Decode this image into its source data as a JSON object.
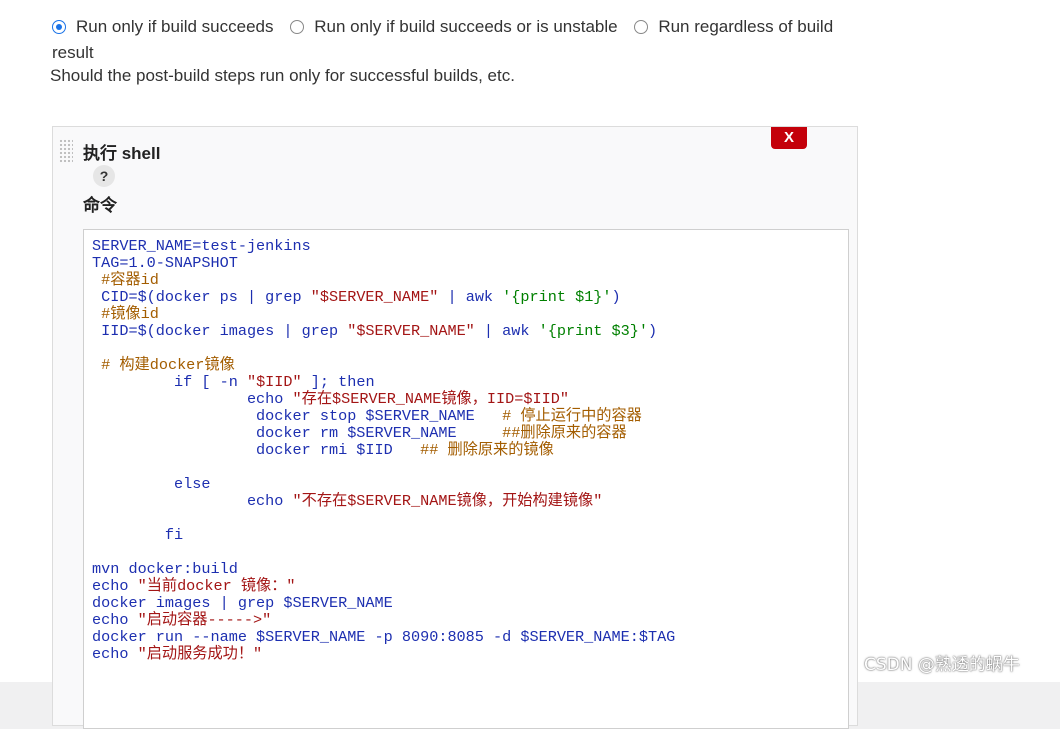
{
  "post_build": {
    "options": [
      {
        "label": "Run only if build succeeds",
        "selected": true
      },
      {
        "label": "Run only if build succeeds or is unstable",
        "selected": false
      },
      {
        "label": "Run regardless of build result",
        "selected": false
      }
    ],
    "help_text": "Should the post-build steps run only for successful builds, etc."
  },
  "step": {
    "title": "执行 shell",
    "help_label": "?",
    "delete_label": "X",
    "command_label": "命令",
    "code_lines": [
      "SERVER_NAME=test-jenkins",
      "TAG=1.0-SNAPSHOT",
      " #容器id",
      " CID=$(docker ps | grep \"$SERVER_NAME\" | awk '{print $1}')",
      " #镜像id",
      " IID=$(docker images | grep \"$SERVER_NAME\" | awk '{print $3}')",
      "",
      " # 构建docker镜像",
      "         if [ -n \"$IID\" ]; then",
      "                 echo \"存在$SERVER_NAME镜像，IID=$IID\"",
      "                  docker stop $SERVER_NAME   # 停止运行中的容器",
      "                  docker rm $SERVER_NAME     ##删除原来的容器",
      "                  docker rmi $IID   ## 删除原来的镜像",
      "",
      "         else",
      "                 echo \"不存在$SERVER_NAME镜像，开始构建镜像\"",
      "",
      "        fi",
      "",
      "mvn docker:build",
      "echo \"当前docker 镜像：\"",
      "docker images | grep $SERVER_NAME",
      "echo \"启动容器----->\"",
      "docker run --name $SERVER_NAME -p 8090:8085 -d $SERVER_NAME:$TAG",
      "echo \"启动服务成功！\""
    ]
  },
  "watermark": "CSDN @熟透的蜗牛",
  "colors": {
    "radio_accent": "#1a73e8",
    "delete_button": "#c4000a",
    "code_text": "#1d2fb0",
    "code_comment": "#a35d00",
    "code_string": "#a31515",
    "code_green": "#008000"
  }
}
